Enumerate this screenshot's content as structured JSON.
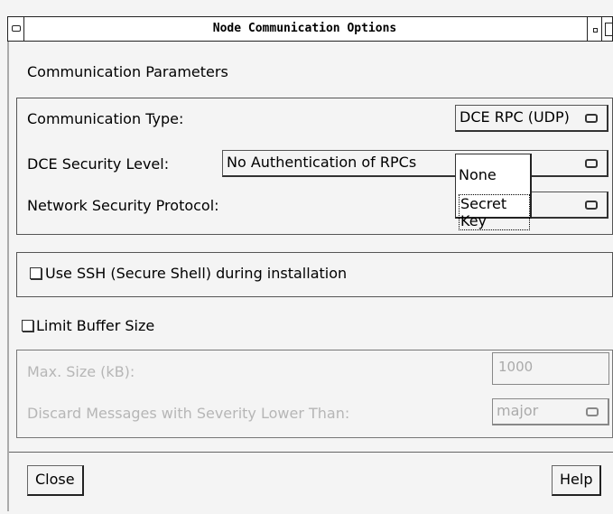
{
  "window": {
    "title": "Node Communication Options"
  },
  "communication": {
    "section_label": "Communication Parameters",
    "type_label": "Communication Type:",
    "type_value": "DCE RPC (UDP)",
    "security_label": "DCE Security Level:",
    "security_value": "No Authentication of RPCs",
    "protocol_label": "Network Security Protocol:",
    "protocol_popup": {
      "options": [
        "None",
        "Secret Key"
      ],
      "selected": "Secret Key"
    }
  },
  "ssh": {
    "label": "Use SSH (Secure Shell) during installation",
    "checked": false
  },
  "buffer": {
    "label": "Limit Buffer Size",
    "checked": false,
    "max_size_label": "Max. Size (kB):",
    "max_size_value": "1000",
    "discard_label": "Discard Messages with Severity Lower Than:",
    "discard_value": "major"
  },
  "footer": {
    "close_label": "Close",
    "help_label": "Help"
  }
}
